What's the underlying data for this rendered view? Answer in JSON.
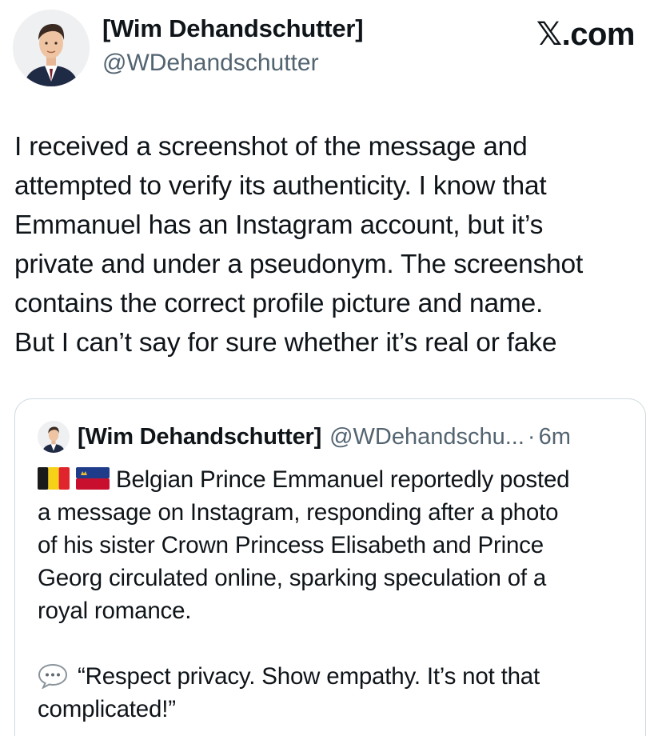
{
  "author": {
    "display_name": "[Wim Dehandschutter]",
    "handle": "@WDehandschutter",
    "avatar_icon": "profile-photo-icon"
  },
  "brand": {
    "label": ".com",
    "glyph": "𝕏"
  },
  "tweet": {
    "lines": [
      "I received a screenshot of the message and",
      "attempted to verify its authenticity. I know that",
      "Emmanuel has an Instagram account, but it’s",
      "private and under a pseudonym. The screenshot",
      "contains the correct profile picture and name.",
      "But I can’t say for sure whether it’s real or fake"
    ]
  },
  "quote": {
    "display_name": "[Wim Dehandschutter]",
    "handle": "@WDehandschu...",
    "separator": "·",
    "time": "6m",
    "flags": [
      "belgium-flag-icon",
      "liechtenstein-flag-icon"
    ],
    "lines": [
      "Belgian Prince Emmanuel reportedly posted",
      "a message on Instagram, responding after a photo",
      "of his sister Crown Princess Elisabeth and Prince",
      "Georg circulated online, sparking speculation of a",
      "royal romance."
    ],
    "quote_icon": "speech-bubble-icon",
    "quote_lines": [
      "“Respect privacy. Show empathy. It’s not that",
      "complicated!”"
    ]
  },
  "colors": {
    "text": "#0f1419",
    "secondary_text": "#536471",
    "card_border": "#cfd9de"
  }
}
